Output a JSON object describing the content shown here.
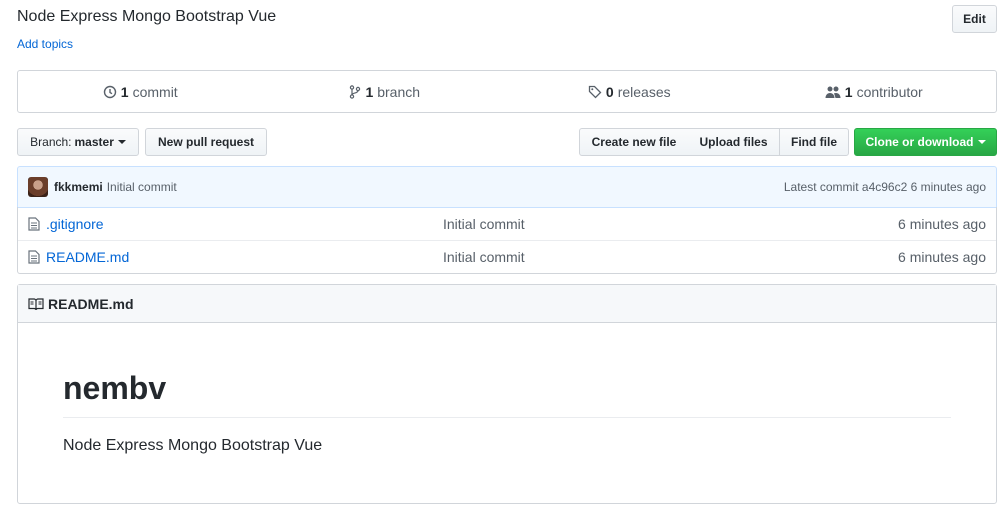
{
  "repo": {
    "description": "Node Express Mongo Bootstrap Vue",
    "add_topics": "Add topics",
    "edit_label": "Edit"
  },
  "summary": {
    "commits_count": "1",
    "commits_label": "commit",
    "branches_count": "1",
    "branches_label": "branch",
    "releases_count": "0",
    "releases_label": "releases",
    "contributors_count": "1",
    "contributors_label": "contributor"
  },
  "toolbar": {
    "branch_prefix": "Branch:",
    "branch_name": "master",
    "new_pr": "New pull request",
    "create_file": "Create new file",
    "upload_files": "Upload files",
    "find_file": "Find file",
    "clone": "Clone or download"
  },
  "latest_commit": {
    "author": "fkkmemi",
    "message": "Initial commit",
    "latest_label": "Latest commit",
    "sha": "a4c96c2",
    "age": "6 minutes ago"
  },
  "files": [
    {
      "name": ".gitignore",
      "commit": "Initial commit",
      "age": "6 minutes ago",
      "icon": "file-icon"
    },
    {
      "name": "README.md",
      "commit": "Initial commit",
      "age": "6 minutes ago",
      "icon": "file-icon"
    }
  ],
  "readme": {
    "header": "README.md",
    "title": "nembv",
    "body": "Node Express Mongo Bootstrap Vue"
  },
  "colors": {
    "link": "#0366d6",
    "clone_green": "#28a745",
    "commit_bar_bg": "#f1f8ff"
  }
}
